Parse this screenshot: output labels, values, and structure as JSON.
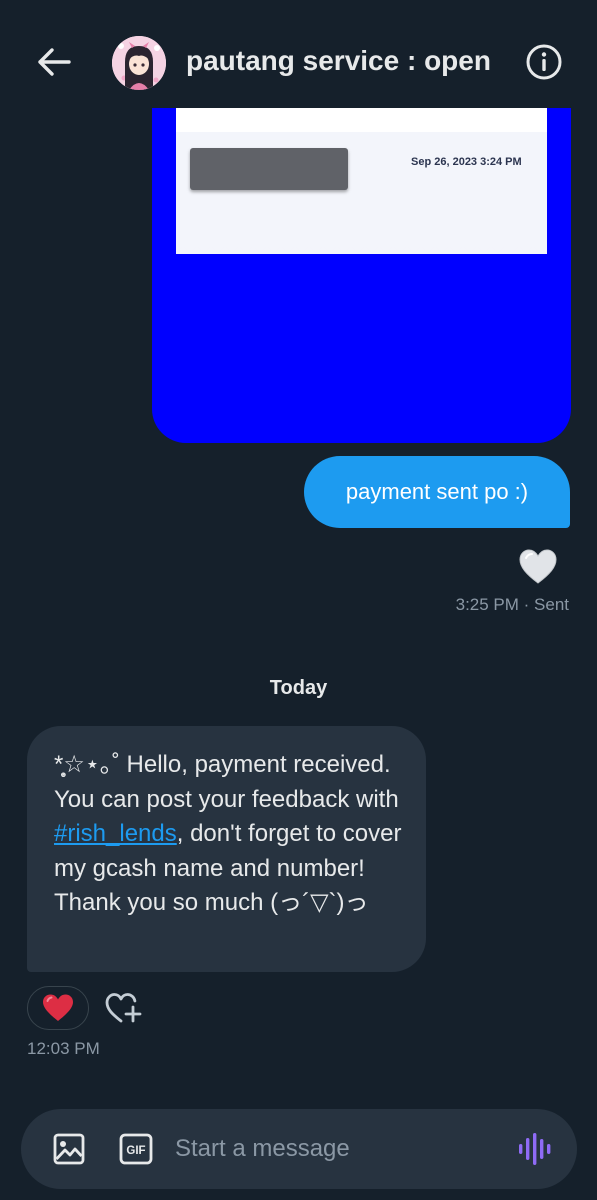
{
  "header": {
    "title": "pautang service : open",
    "back_icon": "arrow-left-icon",
    "info_icon": "info-icon"
  },
  "conversation": {
    "image_message": {
      "background_color": "#0000ff",
      "receipt_date": "Sep 26, 2023 3:24 PM"
    },
    "sent_message": {
      "text": "payment sent po :)",
      "reaction_icon": "heart-icon",
      "meta": "3:25 PM · Sent",
      "bubble_color": "#1d9bf0"
    },
    "date_divider": "Today",
    "received_message": {
      "text_before_hashtag": "*̥͙☆⋆｡˚ Hello, payment received. You can post your feedback with ",
      "hashtag": "#rish_lends",
      "text_after_hashtag": ", don't forget to cover my gcash name and number! Thank you so much (っ´▽`)っ",
      "reaction": "❤️",
      "time": "12:03 PM"
    }
  },
  "composer": {
    "placeholder": "Start a message",
    "media_icon": "image-icon",
    "gif_label": "GIF",
    "voice_icon": "voice-wave-icon",
    "accent_color": "#8f6bf6"
  },
  "colors": {
    "background": "#15202b",
    "bubble_received": "#273340",
    "muted_text": "#8b98a5"
  }
}
